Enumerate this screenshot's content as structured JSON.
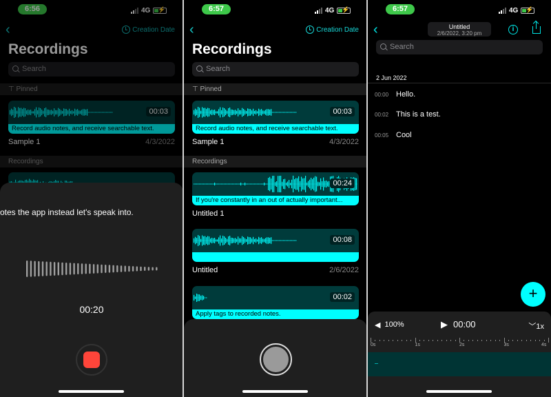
{
  "colors": {
    "accent": "#00ffff",
    "card": "#003b3b",
    "status_pill": "#3ec84a",
    "record": "#ff453a"
  },
  "status": {
    "network": "4G"
  },
  "panel1": {
    "time": "6:56",
    "sort_label": "Creation Date",
    "title": "Recordings",
    "search_placeholder": "Search",
    "pinned_label": "Pinned",
    "recordings_label": "Recordings",
    "pinned": {
      "duration": "00:03",
      "caption": "Record audio notes, and receive searchable text.",
      "name": "Sample 1",
      "date": "4/3/2022"
    },
    "sheet": {
      "transcript": "otes the app instead let's speak into.",
      "elapsed": "00:20"
    }
  },
  "panel2": {
    "time": "6:57",
    "sort_label": "Creation Date",
    "title": "Recordings",
    "search_placeholder": "Search",
    "pinned_label": "Pinned",
    "recordings_label": "Recordings",
    "pinned": {
      "duration": "00:03",
      "caption": "Record audio notes, and receive searchable text.",
      "name": "Sample 1",
      "date": "4/3/2022"
    },
    "items": [
      {
        "duration": "00:24",
        "caption": "If you're constantly in an out of actually important...",
        "name": "Untitled 1",
        "date": ""
      },
      {
        "duration": "00:08",
        "caption": "",
        "name": "Untitled",
        "date": "2/6/2022"
      },
      {
        "duration": "00:02",
        "caption": "Apply tags to recorded notes.",
        "name": "",
        "date": ""
      }
    ]
  },
  "panel3": {
    "time": "6:57",
    "title": "Untitled",
    "subtitle": "2/6/2022, 3:20 pm",
    "search_placeholder": "Search",
    "date_header": "2 Jun 2022",
    "transcript": [
      {
        "time": "00:00",
        "text": "Hello."
      },
      {
        "time": "00:02",
        "text": "This is a test."
      },
      {
        "time": "00:05",
        "text": "Cool"
      }
    ],
    "player": {
      "volume": "100%",
      "position": "00:00",
      "speed": "1x",
      "ruler": [
        "0s",
        "1s",
        "2s",
        "3s",
        "4s"
      ]
    }
  }
}
